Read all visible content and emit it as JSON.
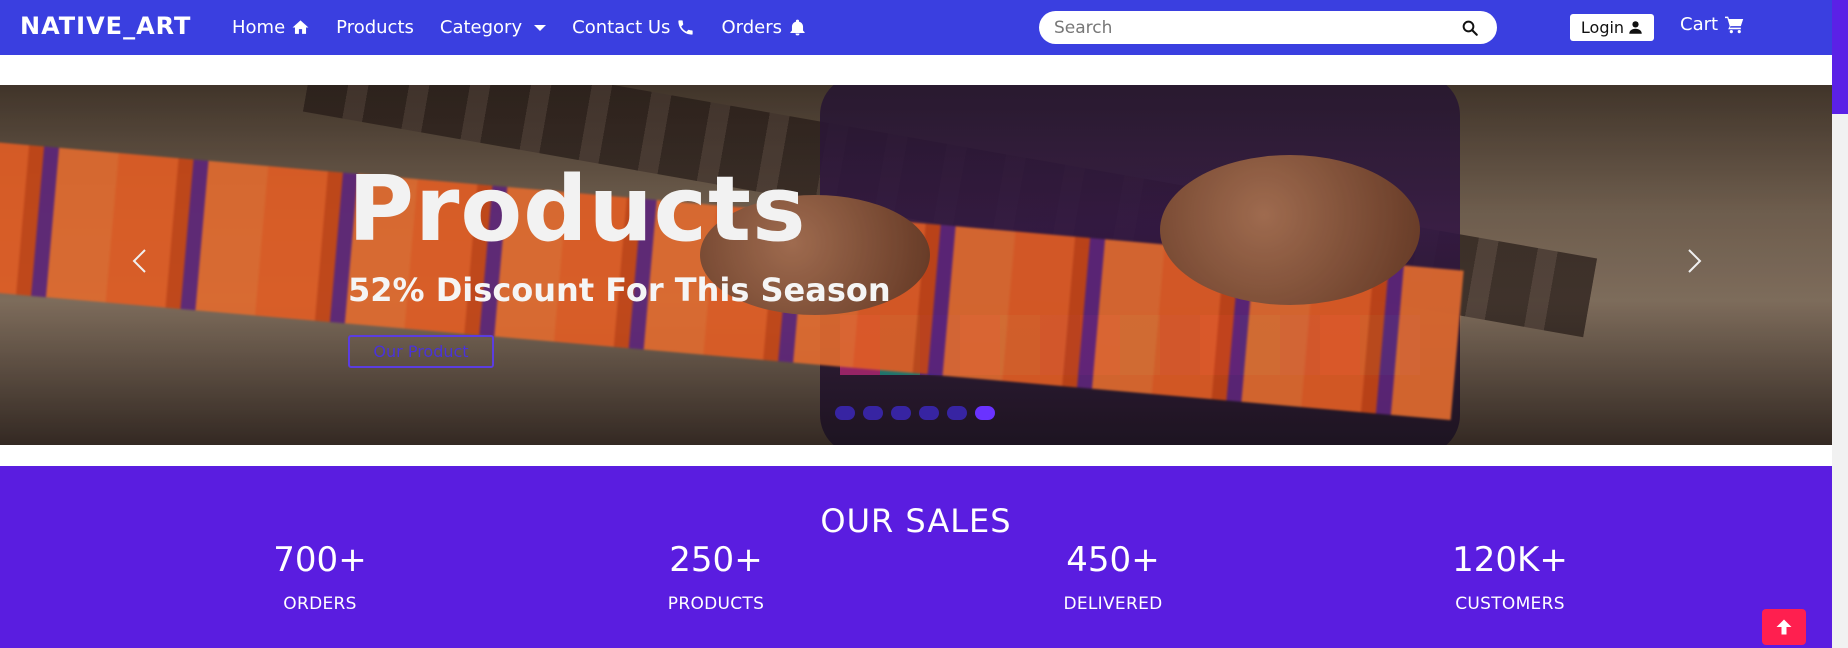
{
  "brand": "NATIVE_ART",
  "nav": {
    "home": "Home",
    "products": "Products",
    "category": "Category",
    "contact": "Contact Us",
    "orders": "Orders"
  },
  "search": {
    "placeholder": "Search"
  },
  "login_label": "Login",
  "cart_label": "Cart",
  "hero": {
    "title": "Products",
    "subtitle": "52% Discount For This Season",
    "button": "Our Product",
    "slide_count": 6,
    "active_slide": 6
  },
  "sales": {
    "title": "OUR SALES",
    "stats": [
      {
        "value": "700+",
        "label": "ORDERS"
      },
      {
        "value": "250+",
        "label": "PRODUCTS"
      },
      {
        "value": "450+",
        "label": "DELIVERED"
      },
      {
        "value": "120K+",
        "label": "CUSTOMERS"
      }
    ]
  },
  "colors": {
    "navbar": "#3a3fe0",
    "sales_bg": "#5a1de0",
    "back_to_top": "#ff1f4f"
  },
  "icons": {
    "home": "home-icon",
    "contact": "phone-icon",
    "orders": "bell-icon",
    "search": "search-icon",
    "login": "user-icon",
    "cart": "cart-icon",
    "back_to_top": "arrow-up-icon"
  }
}
